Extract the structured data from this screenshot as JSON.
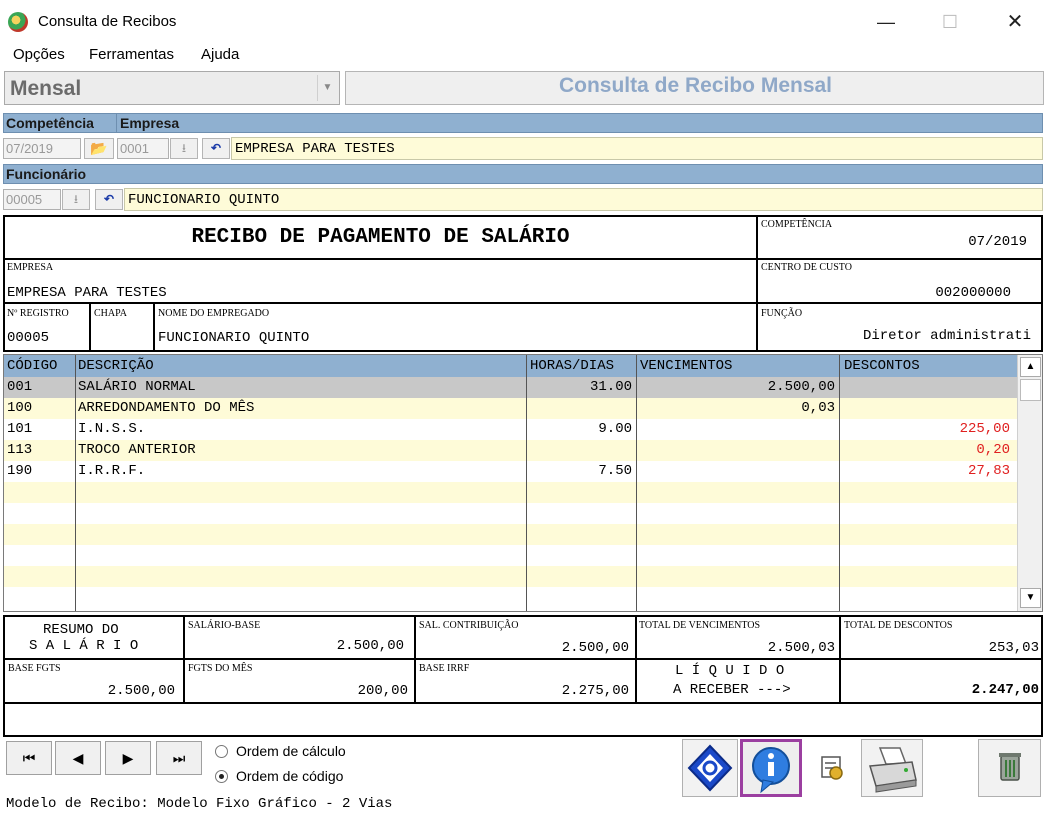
{
  "window": {
    "title": "Consulta de Recibos",
    "min": "—",
    "max": "☐",
    "close": "✕"
  },
  "menu": [
    "Opções",
    "Ferramentas",
    "Ajuda"
  ],
  "selector": {
    "period": "Mensal",
    "arrow": "▼",
    "form_title": "Consulta de Recibo Mensal"
  },
  "filters": {
    "competencia_label": "Competência",
    "empresa_label": "Empresa",
    "competencia": "07/2019",
    "empresa_code": "0001",
    "empresa_name": "EMPRESA PARA TESTES",
    "funcionario_label": "Funcionário",
    "funcionario_code": "00005",
    "funcionario_name": "FUNCIONARIO QUINTO",
    "lookup_glyph": "⭳",
    "undo_glyph": "↶",
    "folder_glyph": "📂"
  },
  "receipt": {
    "title": "RECIBO DE PAGAMENTO DE SALÁRIO",
    "competencia_label": "COMPETÊNCIA",
    "competencia": "07/2019",
    "empresa_label": "EMPRESA",
    "empresa": "EMPRESA PARA TESTES",
    "centro_label": "CENTRO DE CUSTO",
    "centro": "002000000",
    "registro_label": "Nº REGISTRO",
    "registro": "00005",
    "chapa_label": "CHAPA",
    "nome_label": "NOME DO EMPREGADO",
    "nome": "FUNCIONARIO QUINTO",
    "funcao_label": "FUNÇÃO",
    "funcao": "Diretor administrati"
  },
  "table": {
    "headers": [
      "CÓDIGO",
      "DESCRIÇÃO",
      "HORAS/DIAS",
      "VENCIMENTOS",
      "DESCONTOS"
    ],
    "rows": [
      {
        "code": "001",
        "desc": "SALÁRIO NORMAL",
        "hours": "31.00",
        "venc": "2.500,00",
        "desc_val": ""
      },
      {
        "code": "100",
        "desc": "ARREDONDAMENTO DO MÊS",
        "hours": "",
        "venc": "0,03",
        "desc_val": ""
      },
      {
        "code": "101",
        "desc": "I.N.S.S.",
        "hours": "9.00",
        "venc": "",
        "desc_val": "225,00"
      },
      {
        "code": "113",
        "desc": "TROCO ANTERIOR",
        "hours": "",
        "venc": "",
        "desc_val": "0,20"
      },
      {
        "code": "190",
        "desc": "I.R.R.F.",
        "hours": "7.50",
        "venc": "",
        "desc_val": "27,83"
      }
    ],
    "scroll_up": "▲",
    "scroll_down": "▼"
  },
  "summary": {
    "resumo_line1": "RESUMO DO",
    "resumo_line2": "S A L Á R I O",
    "salario_base_label": "SALÁRIO-BASE",
    "salario_base": "2.500,00",
    "sal_contrib_label": "SAL. CONTRIBUIÇÃO",
    "sal_contrib": "2.500,00",
    "total_venc_label": "TOTAL DE VENCIMENTOS",
    "total_venc": "2.500,03",
    "total_desc_label": "TOTAL DE DESCONTOS",
    "total_desc": "253,03",
    "base_fgts_label": "BASE FGTS",
    "base_fgts": "2.500,00",
    "fgts_mes_label": "FGTS DO MÊS",
    "fgts_mes": "200,00",
    "base_irrf_label": "BASE IRRF",
    "base_irrf": "2.275,00",
    "liquido_line1": "L Í Q U I D O",
    "liquido_line2": "A RECEBER --->",
    "liquido": "2.247,00"
  },
  "navigation": {
    "first": "⏮",
    "prev": "◀",
    "next": "▶",
    "last": "⏭"
  },
  "order": {
    "option_calc": "Ordem de cálculo",
    "option_code": "Ordem de código",
    "selected": "code"
  },
  "status": "Modelo de Recibo: Modelo Fixo Gráfico - 2 Vias",
  "colors": {
    "header_band": "#8fb0d0",
    "row_selected": "#c8c8c8",
    "row_alt": "#fefbd8",
    "discount_red": "#e02020",
    "accent_purple": "#9b3fa0"
  }
}
